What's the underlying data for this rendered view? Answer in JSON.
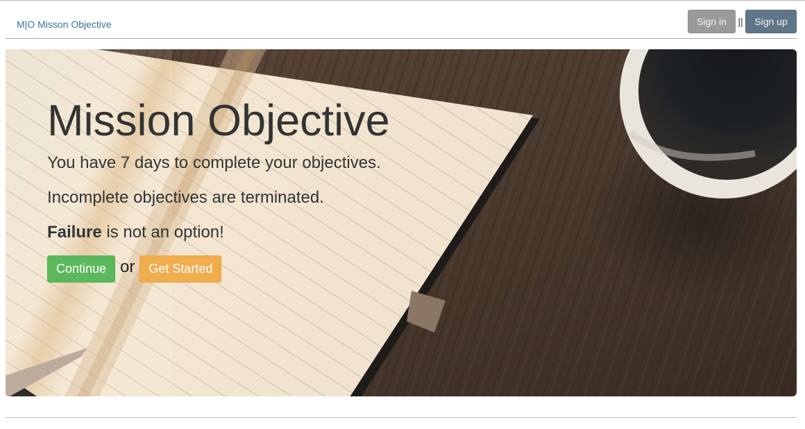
{
  "navbar": {
    "brand": "M|O Misson Objective",
    "sign_in_label": "Sign in",
    "separator": "||",
    "sign_up_label": "Sign up"
  },
  "hero": {
    "title": "Mission Objective",
    "line1": "You have 7 days to complete your objectives.",
    "line2": "Incomplete objectives are terminated.",
    "line3_bold": "Failure",
    "line3_rest": " is not an option!",
    "continue_label": "Continue",
    "or_text": "or",
    "get_started_label": "Get Started"
  },
  "colors": {
    "brand_link": "#3a6f9a",
    "sign_in_bg": "#9a9a9a",
    "sign_up_bg": "#5f7688",
    "success": "#5cb85c",
    "warning": "#f0ad4e",
    "heading_text": "#333333"
  },
  "icons": {
    "hero_background": "notebook-and-coffee-photo"
  }
}
